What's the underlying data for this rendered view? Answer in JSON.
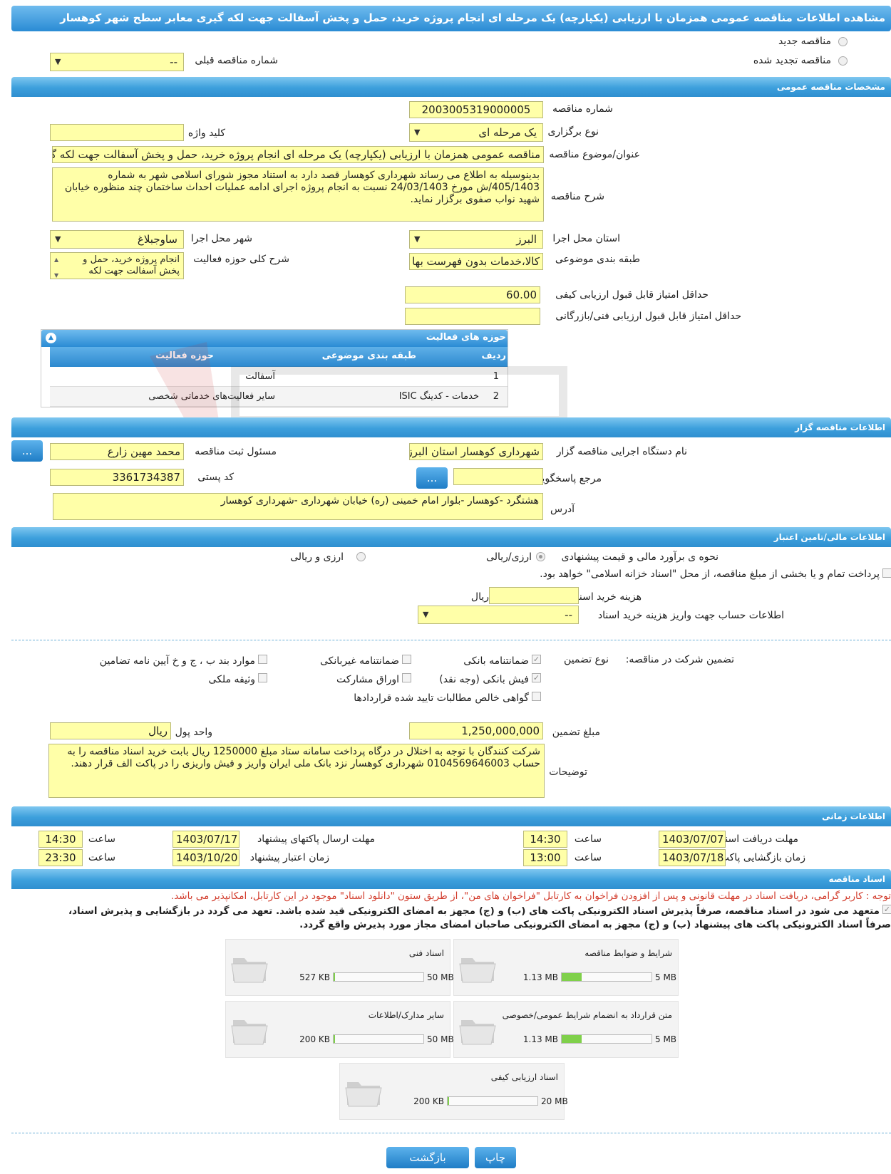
{
  "page_title": "مشاهده اطلاعات مناقصه عمومی همزمان با ارزیابی (یکپارچه) یک مرحله ای انجام پروژه خرید، حمل و پخش آسفالت جهت لکه گیری معابر سطح شهر کوهسار",
  "tender_type": {
    "new_label": "مناقصه جدید",
    "renewed_label": "مناقصه تجدید شده",
    "prev_number_label": "شماره مناقصه قبلی",
    "prev_number_value": "--"
  },
  "sections": {
    "general": "مشخصات مناقصه عمومی",
    "organizer": "اطلاعات مناقصه گزار",
    "financial": "اطلاعات مالی/تامین اعتبار",
    "timing": "اطلاعات زمانی",
    "documents": "اسناد مناقصه"
  },
  "general": {
    "tender_number_label": "شماره مناقصه",
    "tender_number": "2003005319000005",
    "holding_type_label": "نوع برگزاری",
    "holding_type": "یک مرحله ای",
    "keyword_label": "کلید واژه",
    "keyword": "",
    "subject_label": "عنوان/موضوع مناقصه",
    "subject": "مناقصه عمومی همزمان با ارزیابی (یکپارچه) یک مرحله ای انجام پروژه خرید، حمل و پخش آسفالت جهت لکه گیری معابر سطح شهر کوهسار",
    "description_label": "شرح مناقصه",
    "description": "بدینوسیله به اطلاع می رساند شهرداری کوهسار قصد دارد به استناد مجوز شورای اسلامی شهر به شماره 405/1403/ش مورخ 24/03/1403 نسبت به انجام پروژه اجرای ادامه عملیات احداث ساختمان چند منظوره خیابان شهید نواب صفوی برگزار نماید.",
    "province_label": "استان محل اجرا",
    "province": "البرز",
    "city_label": "شهر محل اجرا",
    "city": "ساوجبلاغ",
    "category_label": "طبقه بندی موضوعی",
    "category": "کالا،خدمات بدون فهرست بها",
    "activity_desc_label": "شرح کلی حوزه فعالیت",
    "activity_desc": "انجام پروژه خرید، حمل و پخش آسفالت جهت لکه",
    "min_quality_label": "حداقل امتیاز قابل قبول ارزیابی کیفی",
    "min_quality": "60.00",
    "min_technical_label": "حداقل امتیاز قابل قبول ارزیابی فنی/بازرگانی",
    "min_technical": ""
  },
  "activities": {
    "title": "حوزه های فعالیت",
    "columns": [
      "ردیف",
      "طبقه بندی موضوعی",
      "حوزه فعالیت"
    ],
    "rows": [
      [
        "1",
        "",
        "آسفالت"
      ],
      [
        "2",
        "خدمات - کدینگ ISIC",
        "سایر فعالیت‌های خدماتی شخصی"
      ]
    ]
  },
  "organizer": {
    "agency_label": "نام دستگاه اجرایی مناقصه گزار",
    "agency": "شهرداری کوهسار استان البرز",
    "registrar_label": "مسئول ثبت مناقصه",
    "registrar": "محمد مهین زارع",
    "reference_label": "مرجع پاسخگویی",
    "reference": "",
    "postal_label": "کد پستی",
    "postal": "3361734387",
    "address_label": "آدرس",
    "address": "هشتگرد -کوهسار -بلوار امام خمینی (ره) خیابان شهرداری -شهرداری کوهسار",
    "more_btn": "..."
  },
  "financial": {
    "estimate_label": "نحوه ی برآورد مالی و قیمت پیشنهادی",
    "opt_rial_currency": "ارزی/ریالی",
    "opt_currency_and_rial": "ارزی و ریالی",
    "treasury_text": "پرداخت تمام و یا بخشی از مبلغ مناقصه، از محل \"اسناد خزانه اسلامی\" خواهد بود.",
    "doc_cost_label": "هزینه خرید اسناد",
    "doc_cost": "",
    "doc_cost_unit": "ریال",
    "account_label": "اطلاعات حساب جهت واریز هزینه خرید اسناد",
    "account_value": "--"
  },
  "guarantee": {
    "participation_label": "تضمین شرکت در مناقصه:",
    "type_label": "نوع تضمین",
    "options": {
      "bank_guarantee": "ضمانتنامه بانکی",
      "non_bank_guarantee": "ضمانتنامه غیربانکی",
      "clauses": "موارد بند ب ، ج و خ آیین نامه تضامین",
      "cash_receipt": "فیش بانکی (وجه نقد)",
      "bonds": "اوراق مشارکت",
      "property": "وثیقه ملکی",
      "claims_cert": "گواهی خالص مطالبات تایید شده قراردادها"
    },
    "amount_label": "مبلغ تضمین",
    "amount": "1,250,000,000",
    "currency_label": "واحد پول",
    "currency": "ریال",
    "notes_label": "توضیحات",
    "notes": "شرکت کنندگان با توجه به اختلال در درگاه پرداخت سامانه ستاد مبلغ 1250000 ریال بابت خرید اسناد مناقصه را به حساب 0104569646003 شهرداری کوهسار نزد بانک ملی ایران واریز و فیش واریزی را در پاکت الف قرار دهند."
  },
  "timing": {
    "doc_receive_label": "مهلت دریافت اسناد",
    "doc_receive_date": "1403/07/07",
    "doc_receive_time": "14:30",
    "submit_label": "مهلت ارسال پاکتهای پیشنهاد",
    "submit_date": "1403/07/17",
    "submit_time": "14:30",
    "opening_label": "زمان بازگشایی پاکت ها",
    "opening_date": "1403/07/18",
    "opening_time": "13:00",
    "validity_label": "زمان اعتبار پیشنهاد",
    "validity_date": "1403/10/20",
    "validity_time": "23:30",
    "time_label": "ساعت"
  },
  "documents": {
    "notice": "توجه : کاربر گرامی، دریافت اسناد در مهلت قانونی و پس از افزودن فراخوان به کارتابل \"فراخوان های من\"، از طریق ستون \"دانلود اسناد\" موجود در این کارتابل، امکانپذیر می باشد.",
    "commitment_line1": "متعهد می شود در اسناد مناقصه، صرفاً پذیرش اسناد الکترونیکی پاکت های (ب) و (ج) مجهز به امضای الکترونیکی قید شده باشد. تعهد می گردد در بازگشایی و پذیرش اسناد،",
    "commitment_line2": "صرفاً اسناد الکترونیکی پاکت های پیشنهاد (ب) و (ج) مجهز به امضای الکترونیکی صاحبان امضای مجاز مورد پذیرش واقع گردد.",
    "files": [
      {
        "name": "شرایط و ضوابط مناقصه",
        "current": "1.13 MB",
        "max": "5 MB",
        "fraction": 0.226
      },
      {
        "name": "اسناد فنی",
        "current": "527 KB",
        "max": "50 MB",
        "fraction": 0.0103
      },
      {
        "name": "متن قرارداد به انضمام شرایط عمومی/خصوصی",
        "current": "1.13 MB",
        "max": "5 MB",
        "fraction": 0.226
      },
      {
        "name": "سایر مدارک/اطلاعات",
        "current": "200 KB",
        "max": "50 MB",
        "fraction": 0.004
      },
      {
        "name": "اسناد ارزیابی کیفی",
        "current": "200 KB",
        "max": "20 MB",
        "fraction": 0.01
      }
    ]
  },
  "buttons": {
    "print": "چاپ",
    "back": "بازگشت"
  },
  "colors": {
    "header_blue": "#2f8fd0",
    "field_yellow": "#ffffa8",
    "notice_red": "#d23a2a",
    "progress_green": "#7fd04a"
  }
}
